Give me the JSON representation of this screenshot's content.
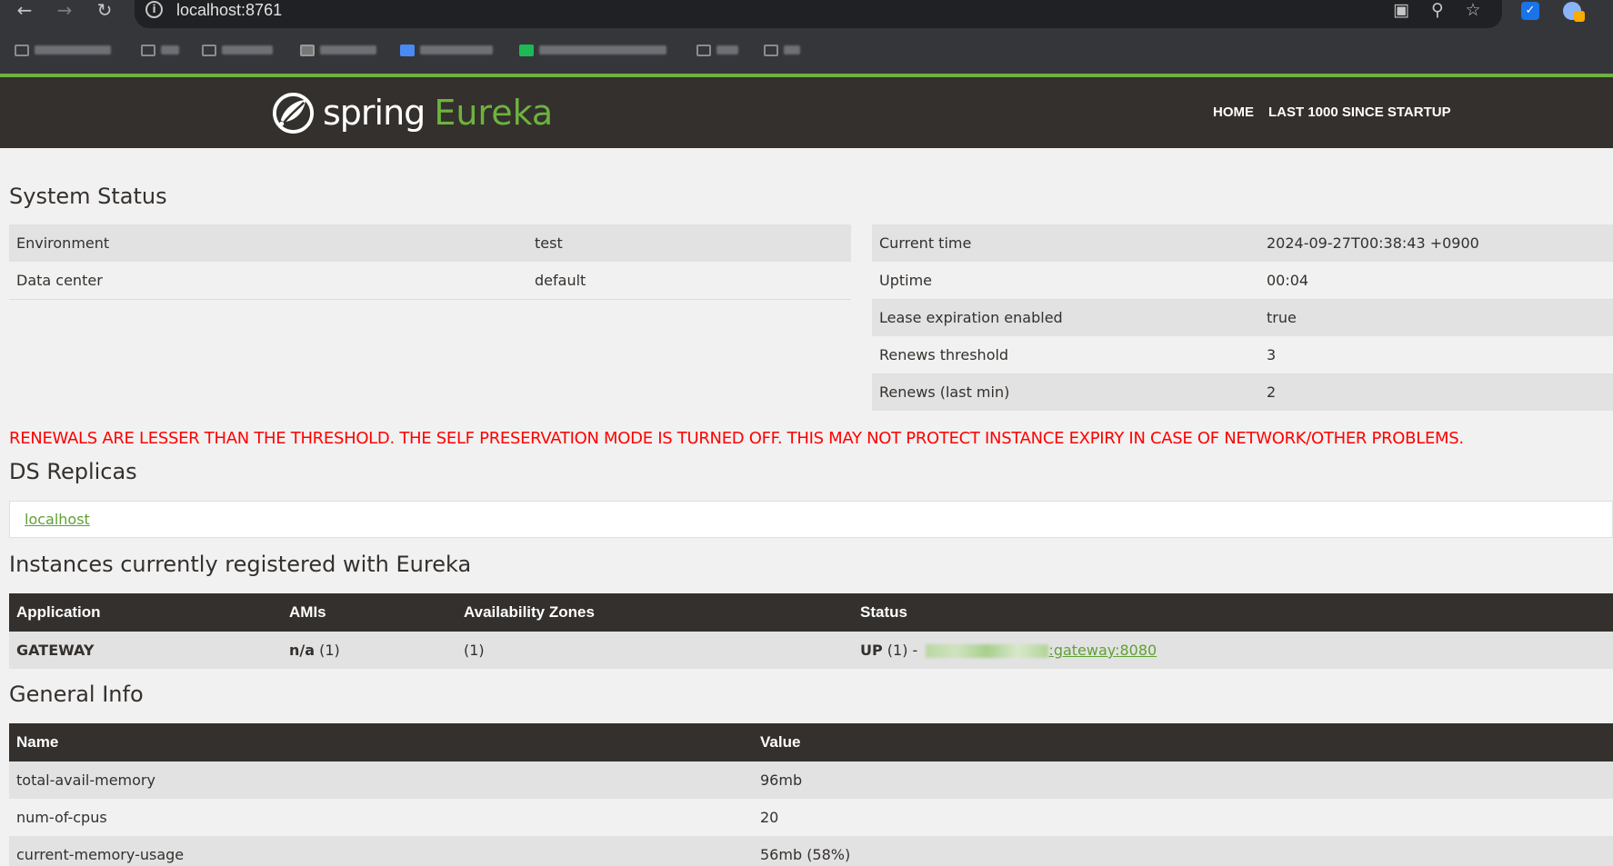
{
  "browser": {
    "url": "localhost:8761"
  },
  "navbar": {
    "logo_spring": "spring",
    "logo_eureka": "Eureka",
    "links": [
      "HOME",
      "LAST 1000 SINCE STARTUP"
    ]
  },
  "system_status": {
    "heading": "System Status",
    "left": [
      {
        "label": "Environment",
        "value": "test"
      },
      {
        "label": "Data center",
        "value": "default"
      }
    ],
    "right": [
      {
        "label": "Current time",
        "value": "2024-09-27T00:38:43 +0900"
      },
      {
        "label": "Uptime",
        "value": "00:04"
      },
      {
        "label": "Lease expiration enabled",
        "value": "true"
      },
      {
        "label": "Renews threshold",
        "value": "3"
      },
      {
        "label": "Renews (last min)",
        "value": "2"
      }
    ]
  },
  "warning": "RENEWALS ARE LESSER THAN THE THRESHOLD. THE SELF PRESERVATION MODE IS TURNED OFF. THIS MAY NOT PROTECT INSTANCE EXPIRY IN CASE OF NETWORK/OTHER PROBLEMS.",
  "ds_replicas": {
    "heading": "DS Replicas",
    "link": "localhost"
  },
  "instances": {
    "heading": "Instances currently registered with Eureka",
    "columns": [
      "Application",
      "AMIs",
      "Availability Zones",
      "Status"
    ],
    "rows": [
      {
        "application": "GATEWAY",
        "amis_bold": "n/a",
        "amis_count": " (1)",
        "zones": "(1)",
        "status_bold": "UP",
        "status_count": " (1) - ",
        "instance_link": ":gateway:8080"
      }
    ]
  },
  "general_info": {
    "heading": "General Info",
    "columns": [
      "Name",
      "Value"
    ],
    "rows": [
      {
        "name": "total-avail-memory",
        "value": "96mb"
      },
      {
        "name": "num-of-cpus",
        "value": "20"
      },
      {
        "name": "current-memory-usage",
        "value": "56mb (58%)"
      }
    ]
  },
  "colors": {
    "brand_green": "#6db33f",
    "navbar_bg": "#34302d",
    "warning_red": "#ff0000"
  }
}
